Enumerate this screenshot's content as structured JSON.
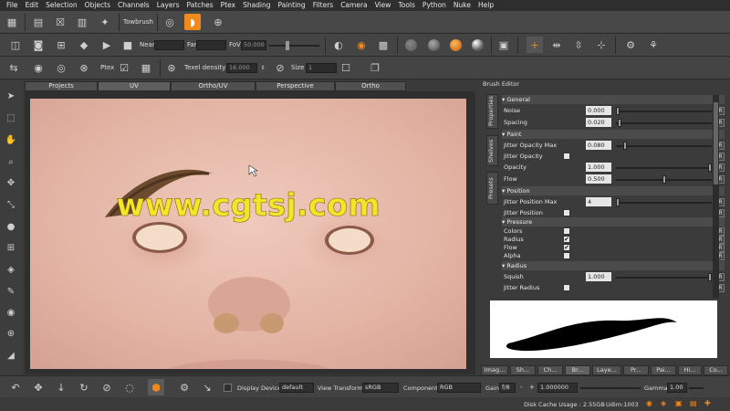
{
  "menu": [
    "File",
    "Edit",
    "Selection",
    "Objects",
    "Channels",
    "Layers",
    "Patches",
    "Ptex",
    "Shading",
    "Painting",
    "Filters",
    "Camera",
    "View",
    "Tools",
    "Python",
    "Nuke",
    "Help"
  ],
  "toolbar1": {
    "towbrush_label": "Towbrush"
  },
  "toolbar2": {
    "near_label": "Near",
    "far_label": "Far",
    "fov_label": "FoV",
    "fov_value": "50.000"
  },
  "toolbar3": {
    "ptex_label": "Ptex",
    "texel_label": "Texel density :",
    "texel_value": "16.000",
    "size_label": "Size :",
    "size_value": "1"
  },
  "view_tabs": [
    "Projects",
    "UV",
    "Ortho/UV",
    "Perspective",
    "Ortho"
  ],
  "viewport": {
    "watermark": "www.cgtsj.com"
  },
  "brush_editor": {
    "title": "Brush Editor",
    "side_tabs": [
      "Properties",
      "Shelves",
      "Presets"
    ],
    "sections": {
      "general": "General",
      "paint": "Paint",
      "position": "Position",
      "pressure": "Pressure",
      "radius": "Radius"
    },
    "rows": {
      "noise": {
        "label": "Noise",
        "value": "0.000",
        "level": 0.0
      },
      "spacing": {
        "label": "Spacing",
        "value": "0.020",
        "level": 0.02
      },
      "jitter_opacity_max": {
        "label": "Jitter Opacity Max",
        "value": "0.080",
        "level": 0.08
      },
      "jitter_opacity": {
        "label": "Jitter Opacity"
      },
      "opacity": {
        "label": "Opacity",
        "value": "1.000",
        "level": 1.0
      },
      "flow": {
        "label": "Flow",
        "value": "0.500",
        "level": 0.5
      },
      "jitter_position_max": {
        "label": "Jitter Position Max",
        "value": "4",
        "level": 0.0
      },
      "jitter_position": {
        "label": "Jitter Position"
      },
      "p_colors": {
        "label": "Colors",
        "checked": false
      },
      "p_radius": {
        "label": "Radius",
        "checked": true
      },
      "p_flow": {
        "label": "Flow",
        "checked": true
      },
      "p_alpha": {
        "label": "Alpha",
        "checked": false
      },
      "squish": {
        "label": "Squish",
        "value": "1.000",
        "level": 1.0
      },
      "jitter_radius": {
        "label": "Jitter Radius"
      }
    },
    "reset_label": "R",
    "bottom_tabs": [
      "Imag...",
      "Sh...",
      "Ch...",
      "Br...",
      "Laye...",
      "Pr...",
      "Pai...",
      "Hi...",
      "Co..."
    ]
  },
  "bottom_bar": {
    "display_device_label": "Display Device",
    "display_device_value": "default",
    "view_transform_label": "View Transform",
    "view_transform_value": "sRGB",
    "component_label": "Component",
    "component_value": "RGB",
    "gain_label": "Gain",
    "gain_fstop": "f/8",
    "gain_value": "1.000000",
    "gamma_label": "Gamma",
    "gamma_value": "1.00"
  },
  "status": {
    "disk_cache": "Disk Cache Usage : 2.55GB",
    "udim": "Udim:1003"
  },
  "colors": {
    "accent_orange": "#f08a1c",
    "watermark_yellow": "#f5e52a"
  }
}
